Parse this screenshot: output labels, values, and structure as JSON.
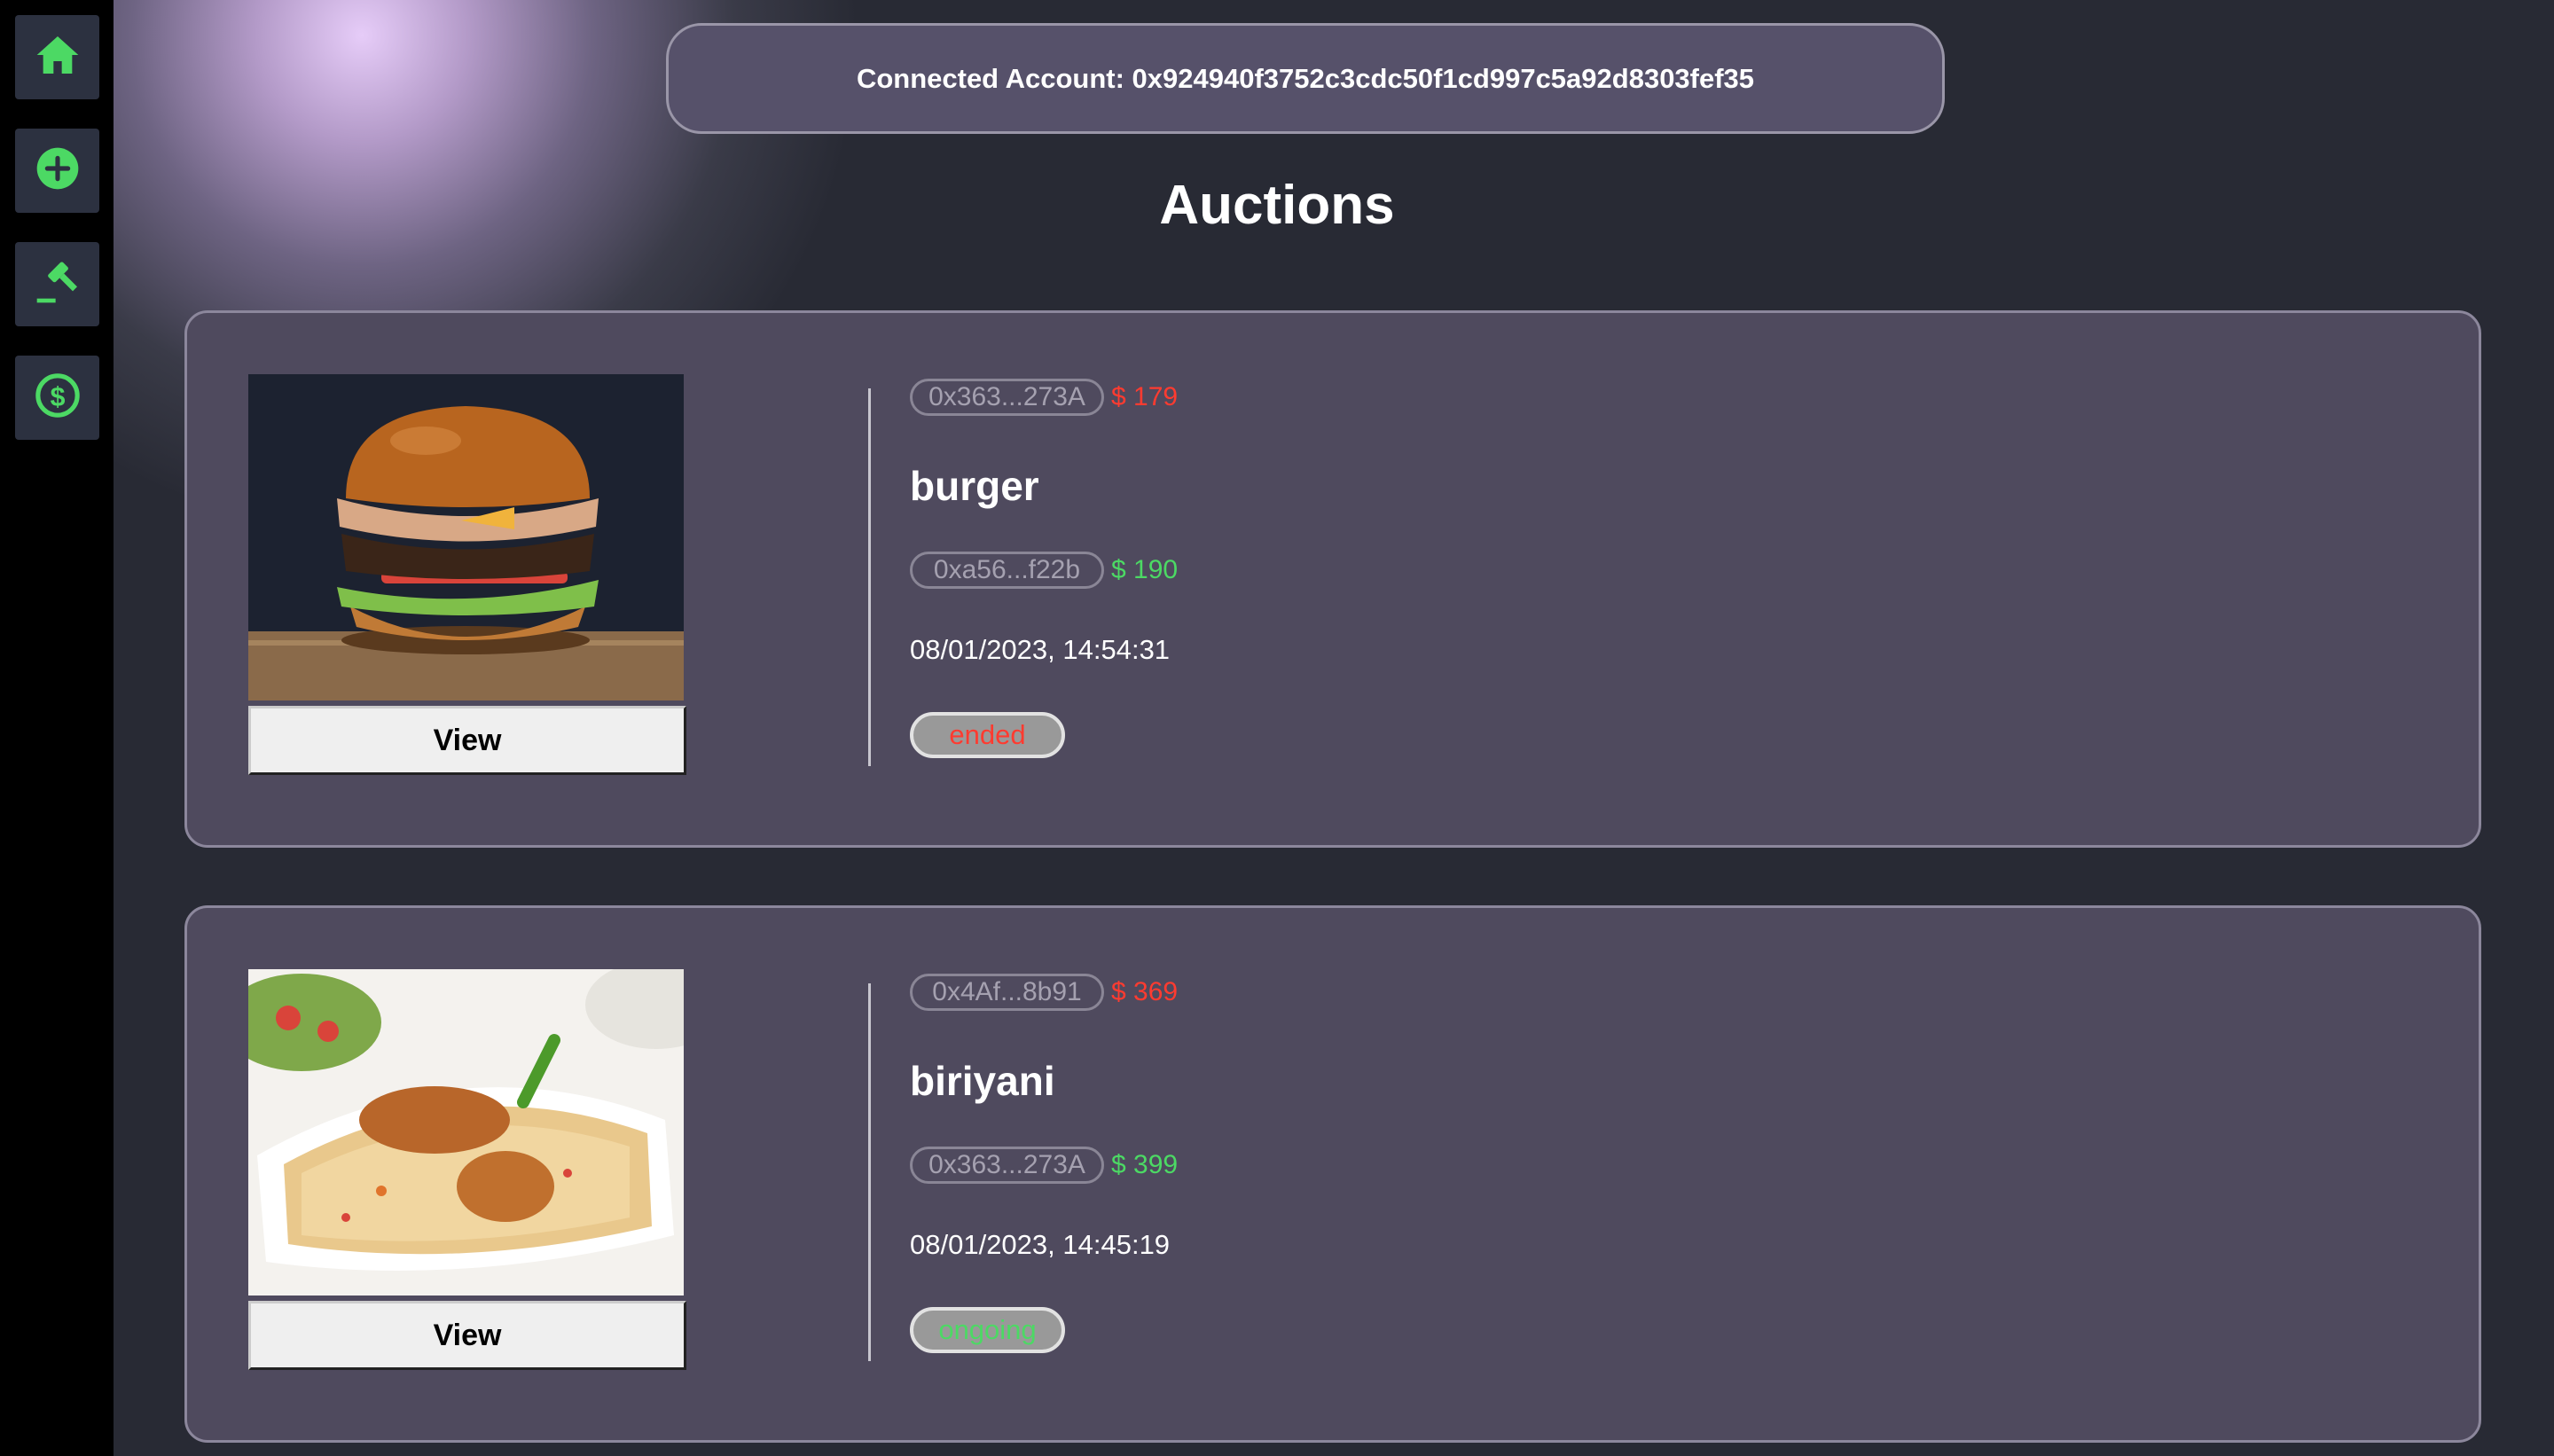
{
  "sidebar": {
    "items": [
      {
        "icon": "home-icon",
        "label": "Home"
      },
      {
        "icon": "plus-circle-icon",
        "label": "Create"
      },
      {
        "icon": "gavel-icon",
        "label": "Auctions"
      },
      {
        "icon": "dollar-circle-icon",
        "label": "Bids"
      }
    ]
  },
  "header": {
    "account_text": "Connected Account: 0x924940f3752c3cdc50f1cd997c5a92d8303fef35"
  },
  "page": {
    "title": "Auctions"
  },
  "auctions": [
    {
      "owner_address": "0x363...273A",
      "starting_price": "$ 179",
      "name": "burger",
      "bidder_address": "0xa56...f22b",
      "highest_bid": "$ 190",
      "date": "08/01/2023, 14:54:31",
      "status": "ended",
      "view_label": "View"
    },
    {
      "owner_address": "0x4Af...8b91",
      "starting_price": "$ 369",
      "name": "biriyani",
      "bidder_address": "0x363...273A",
      "highest_bid": "$ 399",
      "date": "08/01/2023, 14:45:19",
      "status": "ongoing",
      "view_label": "View"
    }
  ],
  "colors": {
    "accent_green": "#4cd964",
    "accent_red": "#ff3b30",
    "card_bg": "#4f4a5e",
    "page_bg": "#282a34"
  }
}
